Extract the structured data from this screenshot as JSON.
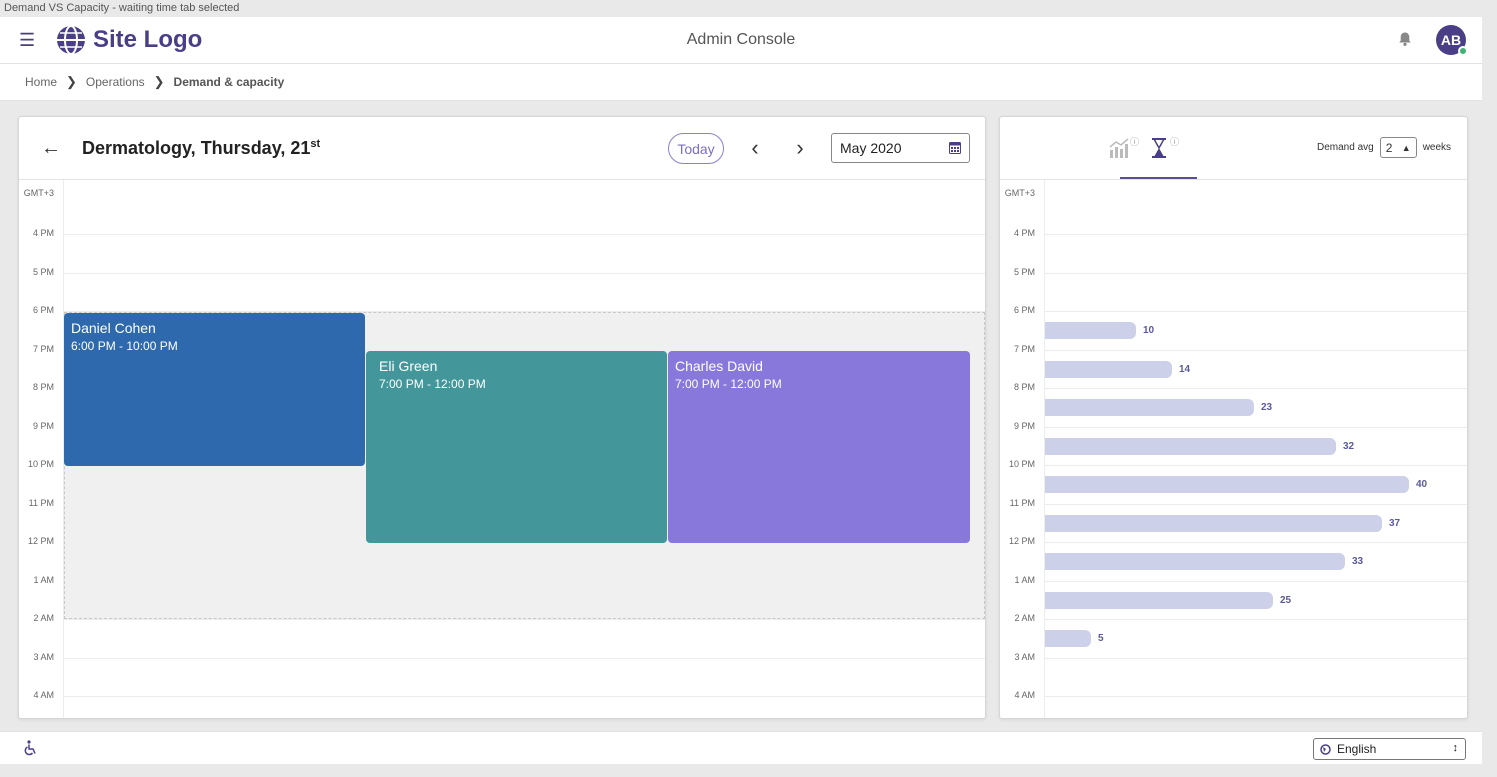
{
  "window": {
    "title": "Demand VS Capacity - waiting time tab selected"
  },
  "header": {
    "logo_text": "Site Logo",
    "title": "Admin Console",
    "avatar_initials": "AB"
  },
  "breadcrumb": {
    "items": [
      "Home",
      "Operations",
      "Demand & capacity"
    ]
  },
  "calendar": {
    "title": "Dermatology, Thursday, 21",
    "title_suffix": "st",
    "today_label": "Today",
    "month_value": "May 2020",
    "timezone": "GMT+3",
    "hours": [
      "4 PM",
      "5 PM",
      "6 PM",
      "7 PM",
      "8 PM",
      "9 PM",
      "10 PM",
      "11 PM",
      "12 PM",
      "1 AM",
      "2 AM",
      "3 AM",
      "4 AM"
    ],
    "events": [
      {
        "name": "Daniel Cohen",
        "time": "6:00 PM - 10:00 PM",
        "color": "#2e68ad"
      },
      {
        "name": "Eli Green",
        "time": "7:00 PM - 12:00 PM",
        "color": "#43979a"
      },
      {
        "name": "Charles David",
        "time": "7:00 PM - 12:00 PM",
        "color": "#8878dc"
      }
    ]
  },
  "waiting_panel": {
    "tabs": [
      {
        "icon": "bar-chart-icon",
        "selected": false
      },
      {
        "icon": "hourglass-icon",
        "selected": true
      }
    ],
    "demand_avg_label": "Demand avg",
    "demand_avg_value": "2",
    "weeks_label": "weeks",
    "timezone": "GMT+3",
    "hours": [
      "4 PM",
      "5 PM",
      "6 PM",
      "7 PM",
      "8 PM",
      "9 PM",
      "10 PM",
      "11 PM",
      "12 PM",
      "1 AM",
      "2 AM",
      "3 AM",
      "4 AM"
    ]
  },
  "chart_data": {
    "type": "bar",
    "orientation": "horizontal",
    "categories": [
      "6 PM",
      "7 PM",
      "8 PM",
      "9 PM",
      "10 PM",
      "11 PM",
      "12 PM",
      "1 AM",
      "2 AM"
    ],
    "values": [
      10,
      14,
      23,
      32,
      40,
      37,
      33,
      25,
      5
    ],
    "bar_color": "#ccd0e8",
    "label_color": "#5a5a9a"
  },
  "footer": {
    "language": "English"
  }
}
